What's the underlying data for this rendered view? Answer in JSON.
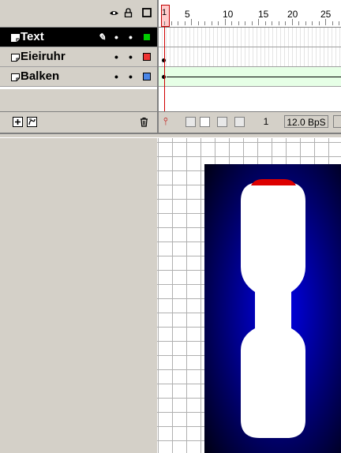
{
  "timeline": {
    "header_icons": [
      "eye-icon",
      "lock-icon",
      "outline-icon"
    ],
    "ruler_labels": [
      "5",
      "10",
      "15",
      "20",
      "25"
    ],
    "current_frame_marker": "1",
    "layers": [
      {
        "name": "Text",
        "selected": true,
        "color": "#00cc00",
        "editing": true
      },
      {
        "name": "Eieiruhr",
        "selected": false,
        "color": "#ee3333",
        "editing": false
      },
      {
        "name": "Balken",
        "selected": false,
        "color": "#4a86e8",
        "editing": false
      }
    ],
    "footer": {
      "current_frame": "1",
      "frame_rate": "12.0 BpS"
    }
  },
  "stage": {
    "background_colors": [
      "#0000ee",
      "#000010"
    ],
    "hourglass_color": "#ffffff",
    "bar_color": "#dd0000"
  }
}
